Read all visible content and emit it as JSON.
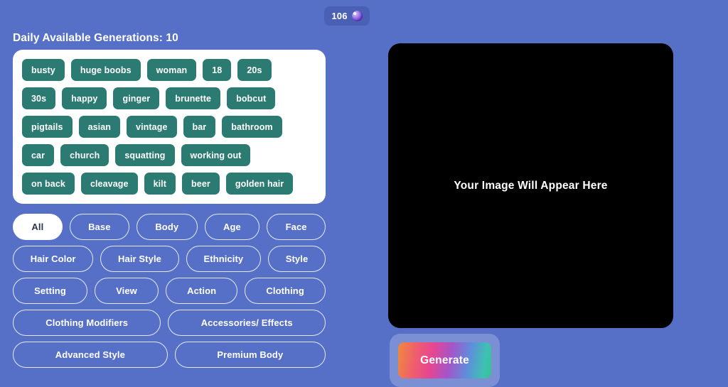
{
  "credit_badge": {
    "count": "106",
    "icon": "gem-icon"
  },
  "left_panel": {
    "generations_label": "Daily Available Generations: 10",
    "tag_rows": [
      [
        "busty",
        "huge boobs",
        "woman",
        "18",
        "20s"
      ],
      [
        "30s",
        "happy",
        "ginger",
        "brunette",
        "bobcut"
      ],
      [
        "pigtails",
        "asian",
        "vintage",
        "bar",
        "bathroom"
      ],
      [
        "car",
        "church",
        "squatting",
        "working out"
      ],
      [
        "on back",
        "cleavage",
        "kilt",
        "beer",
        "golden hair"
      ]
    ],
    "category_rows": [
      [
        {
          "label": "All",
          "active": true
        },
        {
          "label": "Base",
          "active": false
        },
        {
          "label": "Body",
          "active": false
        },
        {
          "label": "Age",
          "active": false
        },
        {
          "label": "Face",
          "active": false
        }
      ],
      [
        {
          "label": "Hair Color",
          "active": false
        },
        {
          "label": "Hair Style",
          "active": false
        },
        {
          "label": "Ethnicity",
          "active": false
        },
        {
          "label": "Style",
          "active": false
        }
      ],
      [
        {
          "label": "Setting",
          "active": false
        },
        {
          "label": "View",
          "active": false
        },
        {
          "label": "Action",
          "active": false
        },
        {
          "label": "Clothing",
          "active": false
        }
      ],
      [
        {
          "label": "Clothing Modifiers",
          "active": false
        },
        {
          "label": "Accessories/ Effects",
          "active": false
        }
      ],
      [
        {
          "label": "Advanced Style",
          "active": false
        },
        {
          "label": "Premium Body",
          "active": false
        }
      ]
    ]
  },
  "right_panel": {
    "placeholder_text": "Your Image Will Appear Here",
    "generate_label": "Generate"
  },
  "colors": {
    "page_background": "#5670c8",
    "tag_chip": "#2b7b73",
    "badge_background": "#4a60b4",
    "preview_background": "#000000",
    "active_pill_text": "#2c3552"
  }
}
